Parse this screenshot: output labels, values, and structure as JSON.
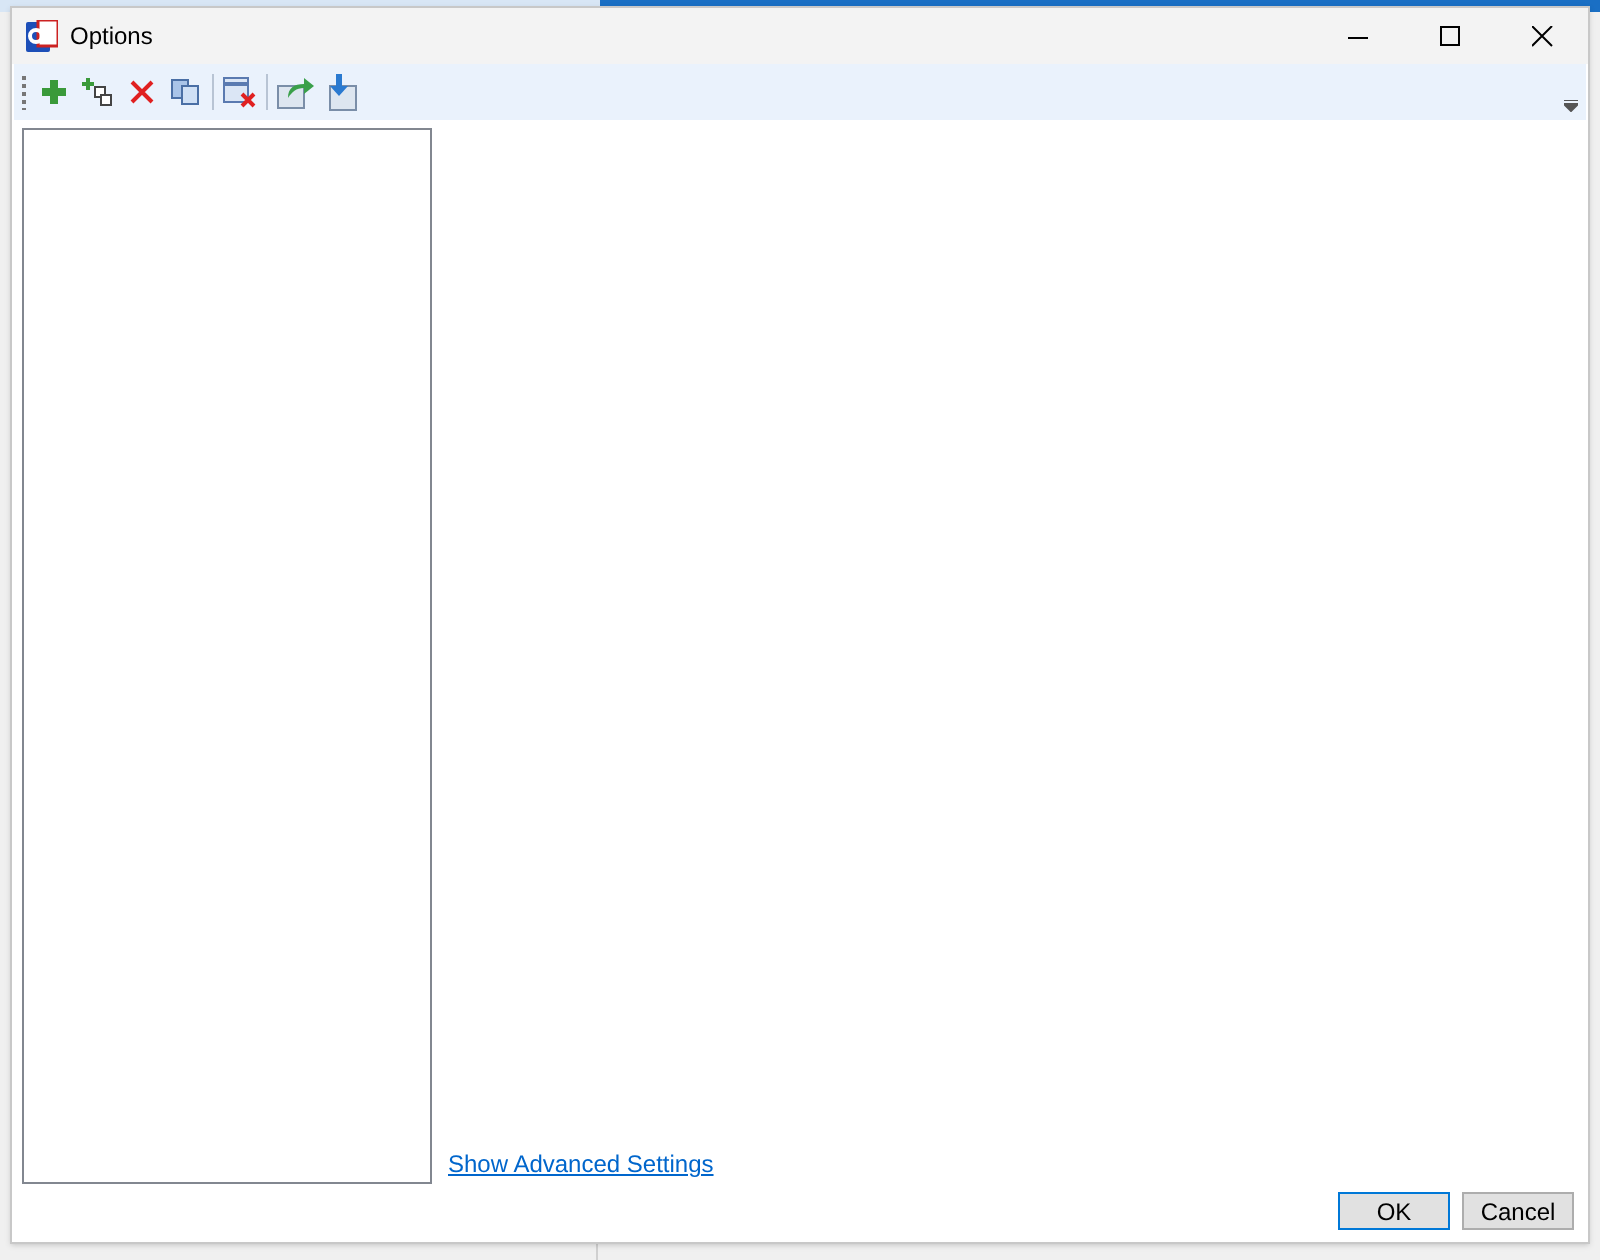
{
  "window": {
    "title": "Options"
  },
  "link": "Show Advanced Settings",
  "buttons": [
    {
      "label": "OK",
      "default": true
    },
    {
      "label": "Cancel",
      "default": false
    }
  ]
}
